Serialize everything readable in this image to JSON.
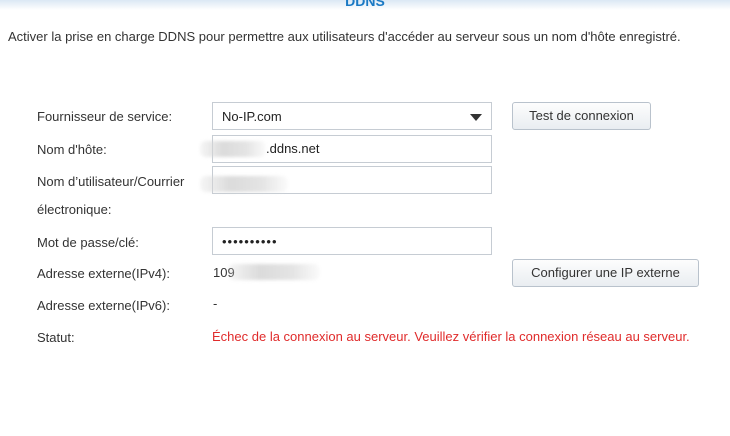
{
  "header": {
    "title": "DDNS"
  },
  "description": "Activer la prise en charge DDNS pour permettre aux utilisateurs d'accéder au serveur sous un nom d'hôte enregistré.",
  "form": {
    "provider": {
      "label": "Fournisseur de service:",
      "value": "No-IP.com"
    },
    "hostname": {
      "label": "Nom d'hôte:",
      "value": ".ddns.net"
    },
    "username": {
      "label_line1": "Nom d’utilisateur/Courrier",
      "label_line2": "électronique:",
      "value": ""
    },
    "password": {
      "label": "Mot de passe/clé:",
      "value": "••••••••••"
    },
    "ipv4": {
      "label": "Adresse externe(IPv4):",
      "value": "109"
    },
    "ipv6": {
      "label": "Adresse externe(IPv6):",
      "value": "-"
    },
    "status": {
      "label": "Statut:",
      "value": "Échec de la connexion au serveur. Veuillez vérifier la connexion réseau au serveur."
    }
  },
  "buttons": {
    "test_connection": "Test de connexion",
    "configure_ip": "Configurer une IP externe"
  },
  "colors": {
    "title": "#1a79c4",
    "error": "#e02b2b"
  },
  "icons": {
    "dropdown": "chevron-down-icon"
  }
}
